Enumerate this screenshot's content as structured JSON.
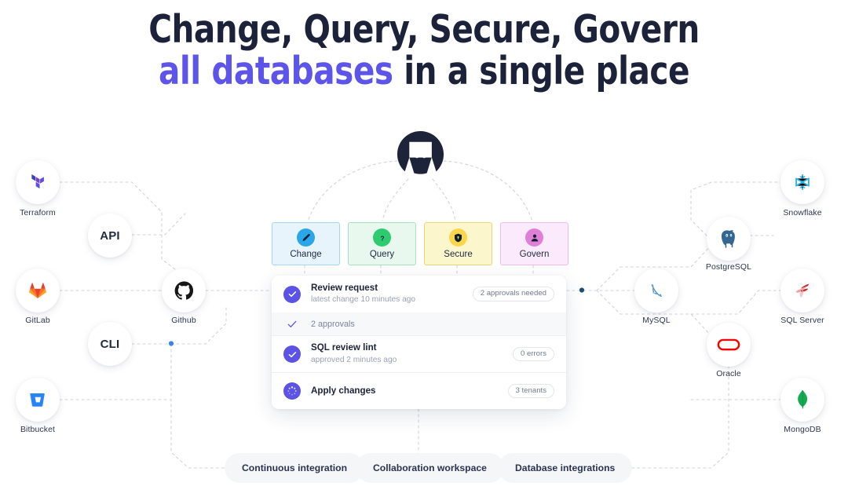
{
  "heading": {
    "line1": "Change, Query, Secure, Govern",
    "line2_accent": "all databases",
    "line2_rest": " in a single place",
    "accent_color": "#5d55ea",
    "text_color": "#1b2239"
  },
  "brand": {
    "logo_name": "bytebase-logo",
    "logo_color": "#1d2439"
  },
  "left_nodes": [
    {
      "label": "Terraform",
      "icon": "terraform-icon",
      "color": "#7b42bc"
    },
    {
      "label": "GitLab",
      "icon": "gitlab-icon",
      "color": "#fc6d26"
    },
    {
      "label": "Bitbucket",
      "icon": "bitbucket-icon",
      "color": "#2684ff"
    },
    {
      "label": "Github",
      "icon": "github-icon",
      "color": "#181717"
    }
  ],
  "left_pills": [
    {
      "label": "API"
    },
    {
      "label": "CLI"
    }
  ],
  "right_nodes": [
    {
      "label": "Snowflake",
      "icon": "snowflake-icon",
      "color": "#29b5e8"
    },
    {
      "label": "PostgreSQL",
      "icon": "postgresql-icon",
      "color": "#336791"
    },
    {
      "label": "SQL Server",
      "icon": "sql-server-icon",
      "color": "#cc2927"
    },
    {
      "label": "MongoDB",
      "icon": "mongodb-icon",
      "color": "#13aa52"
    },
    {
      "label": "MySQL",
      "icon": "mysql-icon",
      "color": "#4479a1"
    },
    {
      "label": "Oracle",
      "icon": "oracle-icon",
      "color": "#f80000"
    }
  ],
  "categories": [
    {
      "label": "Change",
      "icon": "pencil-icon",
      "bubble_color": "#29a7e8",
      "card_bg": "#e8f4fc",
      "card_border": "#a9d6ef"
    },
    {
      "label": "Query",
      "icon": "question-icon",
      "bubble_color": "#2ecc71",
      "card_bg": "#e9f8ef",
      "card_border": "#a9e0c0"
    },
    {
      "label": "Secure",
      "icon": "shield-icon",
      "bubble_color": "#fbd64a",
      "card_bg": "#fcf6cd",
      "card_border": "#e8d77a"
    },
    {
      "label": "Govern",
      "icon": "user-icon",
      "bubble_color": "#e07fd8",
      "card_bg": "#fbeafb",
      "card_border": "#e9bde7"
    }
  ],
  "workflow": {
    "accent_color": "#5b52e6",
    "rows": [
      {
        "type": "main",
        "icon": "check-circle-filled-icon",
        "title": "Review request",
        "subtitle": "latest change 10 minutes ago",
        "badge": "2 approvals needed"
      },
      {
        "type": "sub",
        "icon": "check-thin-icon",
        "title": "2 approvals",
        "subtitle": "",
        "badge": ""
      },
      {
        "type": "main",
        "icon": "check-circle-filled-icon",
        "title": "SQL review lint",
        "subtitle": "approved 2 minutes ago",
        "badge": "0 errors"
      },
      {
        "type": "main",
        "icon": "spinner-icon",
        "title": "Apply changes",
        "subtitle": "",
        "badge": "3 tenants"
      }
    ]
  },
  "bottom_pills": [
    {
      "label": "Continuous integration"
    },
    {
      "label": "Collaboration workspace"
    },
    {
      "label": "Database integrations"
    }
  ],
  "connectors": {
    "dash_color": "#cfd3dd",
    "dot_left_color": "#3b82f6",
    "dot_right_color": "#1f4e79"
  }
}
